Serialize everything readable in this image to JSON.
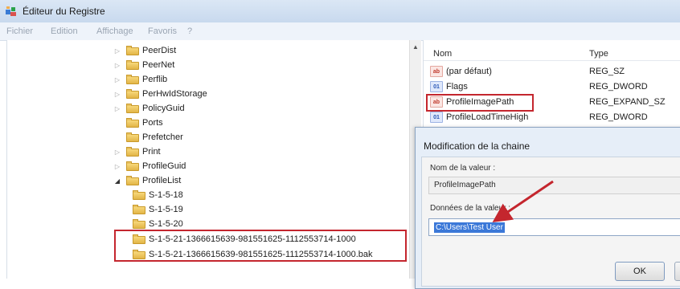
{
  "window": {
    "title": "Éditeur du Registre"
  },
  "menu": {
    "items": [
      "Fichier",
      "Edition",
      "Affichage",
      "Favoris",
      "?"
    ]
  },
  "tree": {
    "items": [
      {
        "label": "PeerDist",
        "expandable": true
      },
      {
        "label": "PeerNet",
        "expandable": true
      },
      {
        "label": "Perflib",
        "expandable": true
      },
      {
        "label": "PerHwIdStorage",
        "expandable": true
      },
      {
        "label": "PolicyGuid",
        "expandable": true
      },
      {
        "label": "Ports",
        "expandable": false
      },
      {
        "label": "Prefetcher",
        "expandable": false
      },
      {
        "label": "Print",
        "expandable": true
      },
      {
        "label": "ProfileGuid",
        "expandable": true
      },
      {
        "label": "ProfileList",
        "expandable": true,
        "expanded": true
      },
      {
        "label": "S-1-5-18",
        "expandable": false
      },
      {
        "label": "S-1-5-19",
        "expandable": false
      },
      {
        "label": "S-1-5-20",
        "expandable": false
      },
      {
        "label": "S-1-5-21-1366615639-981551625-1112553714-1000",
        "expandable": false
      },
      {
        "label": "S-1-5-21-1366615639-981551625-1112553714-1000.bak",
        "expandable": false
      }
    ]
  },
  "values_pane": {
    "columns": {
      "name": "Nom",
      "type": "Type"
    },
    "rows": [
      {
        "name": "(par défaut)",
        "type": "REG_SZ",
        "icon": "string-value-icon"
      },
      {
        "name": "Flags",
        "type": "REG_DWORD",
        "icon": "binary-value-icon"
      },
      {
        "name": "ProfileImagePath",
        "type": "REG_EXPAND_SZ",
        "icon": "string-value-icon"
      },
      {
        "name": "ProfileLoadTimeHigh",
        "type": "REG_DWORD",
        "icon": "binary-value-icon"
      }
    ]
  },
  "dialog": {
    "title": "Modification de la chaine",
    "name_label": "Nom de la valeur :",
    "name_value": "ProfileImagePath",
    "data_label": "Données de la valeur :",
    "data_value": "C:\\Users\\Test User",
    "ok_label": "OK"
  },
  "colors": {
    "highlight": "#c4262e",
    "selection": "#3b78d8"
  }
}
